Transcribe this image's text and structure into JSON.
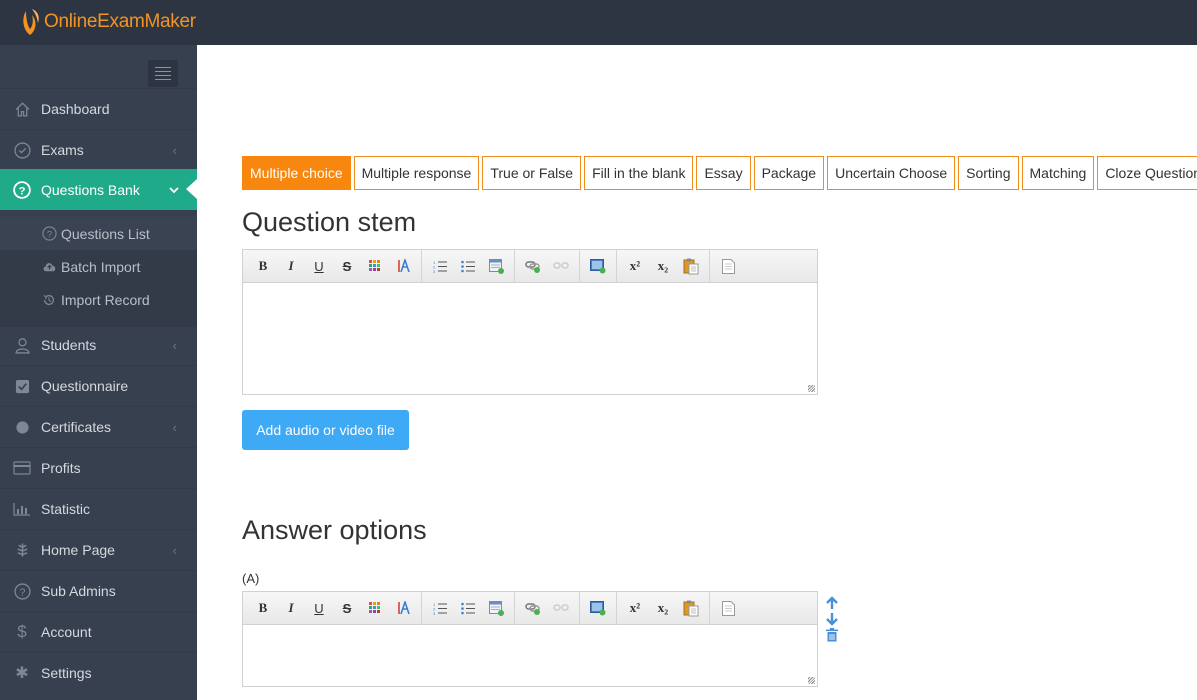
{
  "app": {
    "logo_text": "OnlineExamMaker",
    "brand_color": "#f39422",
    "accent_color": "#1fab89"
  },
  "sidebar": {
    "items": [
      {
        "label": "Dashboard",
        "icon": "home-icon",
        "has_chevron": false
      },
      {
        "label": "Exams",
        "icon": "check-circle-icon",
        "has_chevron": true
      },
      {
        "label": "Questions Bank",
        "icon": "question-circle-icon",
        "has_chevron": true,
        "active": true
      },
      {
        "label": "Students",
        "icon": "user-icon",
        "has_chevron": true
      },
      {
        "label": "Questionnaire",
        "icon": "checkbox-icon",
        "has_chevron": false
      },
      {
        "label": "Certificates",
        "icon": "certificate-icon",
        "has_chevron": true
      },
      {
        "label": "Profits",
        "icon": "credit-card-icon",
        "has_chevron": false
      },
      {
        "label": "Statistic",
        "icon": "bar-chart-icon",
        "has_chevron": false
      },
      {
        "label": "Home Page",
        "icon": "leaf-icon",
        "has_chevron": true
      },
      {
        "label": "Sub Admins",
        "icon": "question-circle-icon",
        "has_chevron": false
      },
      {
        "label": "Account",
        "icon": "dollar-icon",
        "has_chevron": false
      },
      {
        "label": "Settings",
        "icon": "gear-icon",
        "has_chevron": false
      }
    ],
    "sub_items": [
      {
        "label": "Questions List",
        "icon": "question-circle-icon",
        "active": true
      },
      {
        "label": "Batch Import",
        "icon": "cloud-upload-icon"
      },
      {
        "label": "Import Record",
        "icon": "history-icon"
      }
    ]
  },
  "question_types": [
    {
      "label": "Multiple choice",
      "active": true
    },
    {
      "label": "Multiple response"
    },
    {
      "label": "True or False"
    },
    {
      "label": "Fill in the blank"
    },
    {
      "label": "Essay"
    },
    {
      "label": "Package"
    },
    {
      "label": "Uncertain Choose"
    },
    {
      "label": "Sorting"
    },
    {
      "label": "Matching"
    },
    {
      "label": "Cloze Question"
    }
  ],
  "question_stem": {
    "title": "Question stem",
    "value": ""
  },
  "media_button": "Add audio or video file",
  "answer_options": {
    "title": "Answer options",
    "options": [
      {
        "label": "(A)",
        "value": ""
      }
    ]
  },
  "toolbar": {
    "bold": "B",
    "italic": "I",
    "underline": "U",
    "strike": "S",
    "superscript": "x²",
    "subscript": "x₂"
  }
}
